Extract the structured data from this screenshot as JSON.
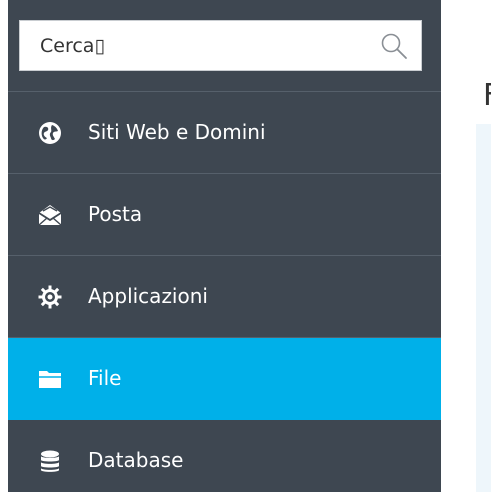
{
  "search": {
    "value": "Cerca▯",
    "icon": "search-icon"
  },
  "nav": {
    "items": [
      {
        "label": "Siti Web e Domini",
        "icon": "globe-icon",
        "active": false
      },
      {
        "label": "Posta",
        "icon": "mail-icon",
        "active": false
      },
      {
        "label": "Applicazioni",
        "icon": "gear-icon",
        "active": false
      },
      {
        "label": "File",
        "icon": "folder-icon",
        "active": true
      },
      {
        "label": "Database",
        "icon": "database-icon",
        "active": false
      }
    ]
  },
  "content": {
    "title_fragment": "F"
  },
  "colors": {
    "sidebar_bg": "#3e4751",
    "active_bg": "#00b0e9",
    "divider": "#56606b"
  }
}
